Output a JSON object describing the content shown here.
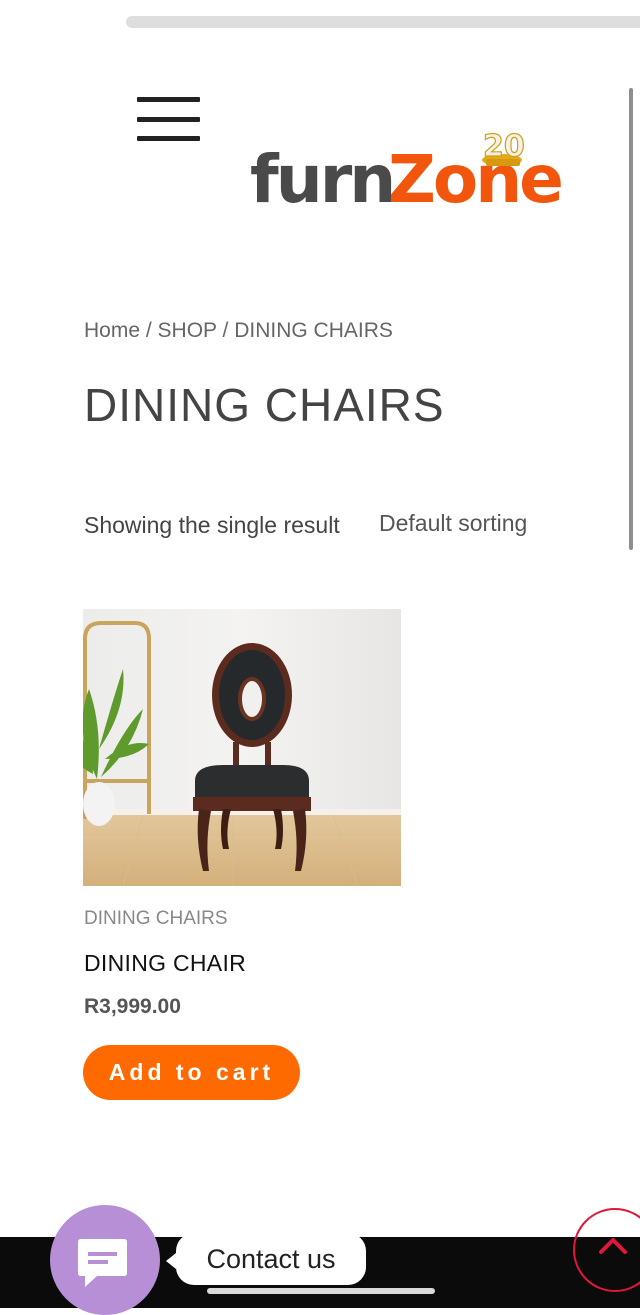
{
  "header": {
    "logo_text_dark": "furn",
    "logo_text_orange": "Zone",
    "logo_badge": "20",
    "menu_icon": "hamburger-menu-icon"
  },
  "breadcrumb": {
    "home": "Home",
    "separator": " / ",
    "shop": "SHOP",
    "current": "DINING CHAIRS"
  },
  "page": {
    "title": "DINING CHAIRS",
    "result_count": "Showing the single result",
    "sorting": "Default sorting"
  },
  "product": {
    "category": "DINING CHAIRS",
    "name": "DINING CHAIR",
    "price": "R3,999.00",
    "add_to_cart_label": "Add to cart"
  },
  "chat": {
    "label": "Contact us",
    "icon": "chat-icon"
  },
  "scroll_top": {
    "icon": "chevron-up-icon"
  },
  "colors": {
    "accent": "#ff6a00",
    "logo_dark": "#4a4a4a",
    "chat_bubble": "#b78fd6",
    "scroll_top_ring": "#e0173a"
  }
}
